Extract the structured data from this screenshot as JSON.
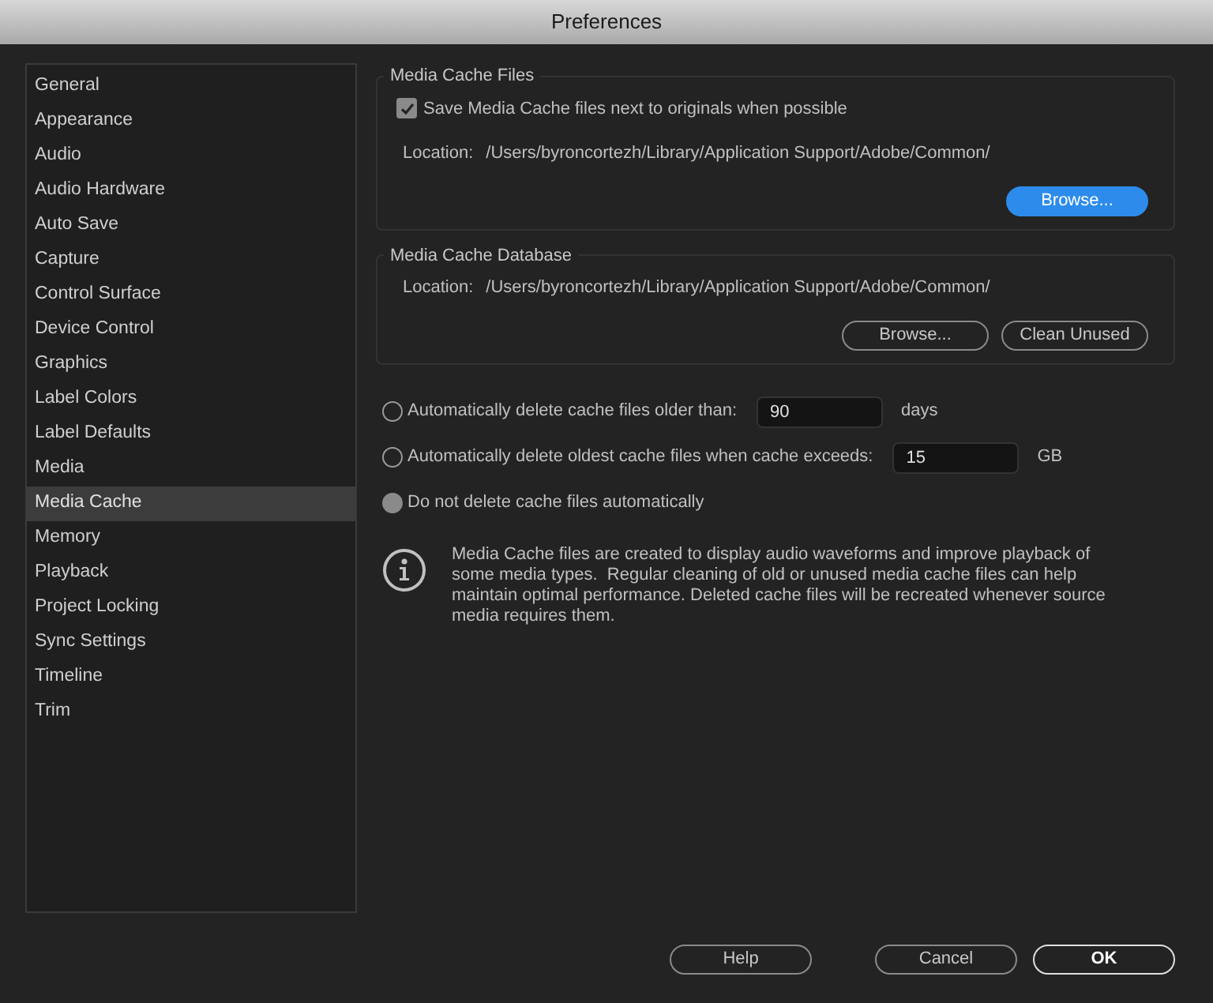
{
  "window": {
    "title": "Preferences"
  },
  "sidebar": {
    "items": [
      {
        "label": "General",
        "selected": false
      },
      {
        "label": "Appearance",
        "selected": false
      },
      {
        "label": "Audio",
        "selected": false
      },
      {
        "label": "Audio Hardware",
        "selected": false
      },
      {
        "label": "Auto Save",
        "selected": false
      },
      {
        "label": "Capture",
        "selected": false
      },
      {
        "label": "Control Surface",
        "selected": false
      },
      {
        "label": "Device Control",
        "selected": false
      },
      {
        "label": "Graphics",
        "selected": false
      },
      {
        "label": "Label Colors",
        "selected": false
      },
      {
        "label": "Label Defaults",
        "selected": false
      },
      {
        "label": "Media",
        "selected": false
      },
      {
        "label": "Media Cache",
        "selected": true
      },
      {
        "label": "Memory",
        "selected": false
      },
      {
        "label": "Playback",
        "selected": false
      },
      {
        "label": "Project Locking",
        "selected": false
      },
      {
        "label": "Sync Settings",
        "selected": false
      },
      {
        "label": "Timeline",
        "selected": false
      },
      {
        "label": "Trim",
        "selected": false
      }
    ]
  },
  "media_cache_files": {
    "title": "Media Cache Files",
    "checkbox": {
      "label": "Save Media Cache files next to originals when possible",
      "checked": true
    },
    "location_label": "Location:",
    "location": "/Users/byroncortezh/Library/Application Support/Adobe/Common/",
    "buttons": [
      {
        "label": "Browse...",
        "primary": true
      }
    ]
  },
  "media_cache_database": {
    "title": "Media Cache Database",
    "location_label": "Location:",
    "location": "/Users/byroncortezh/Library/Application Support/Adobe/Common/",
    "buttons": [
      {
        "label": "Browse...",
        "primary": false
      },
      {
        "label": "Clean Unused",
        "primary": false
      }
    ]
  },
  "options": [
    {
      "label": "Automatically delete cache files older than:",
      "selected": false,
      "value": "90",
      "unit": "days"
    },
    {
      "label": "Automatically delete oldest cache files when cache exceeds:",
      "selected": false,
      "value": "15",
      "unit": "GB"
    },
    {
      "label": "Do not delete cache files automatically",
      "selected": true
    }
  ],
  "info": "Media Cache files are created to display audio waveforms and improve playback of some media types.  Regular cleaning of old or unused media cache files can help maintain optimal performance. Deleted cache files will be recreated whenever source media requires them.",
  "footer_buttons": [
    {
      "label": "Help",
      "default": false
    },
    {
      "label": "Cancel",
      "default": false
    },
    {
      "label": "OK",
      "default": true
    }
  ]
}
